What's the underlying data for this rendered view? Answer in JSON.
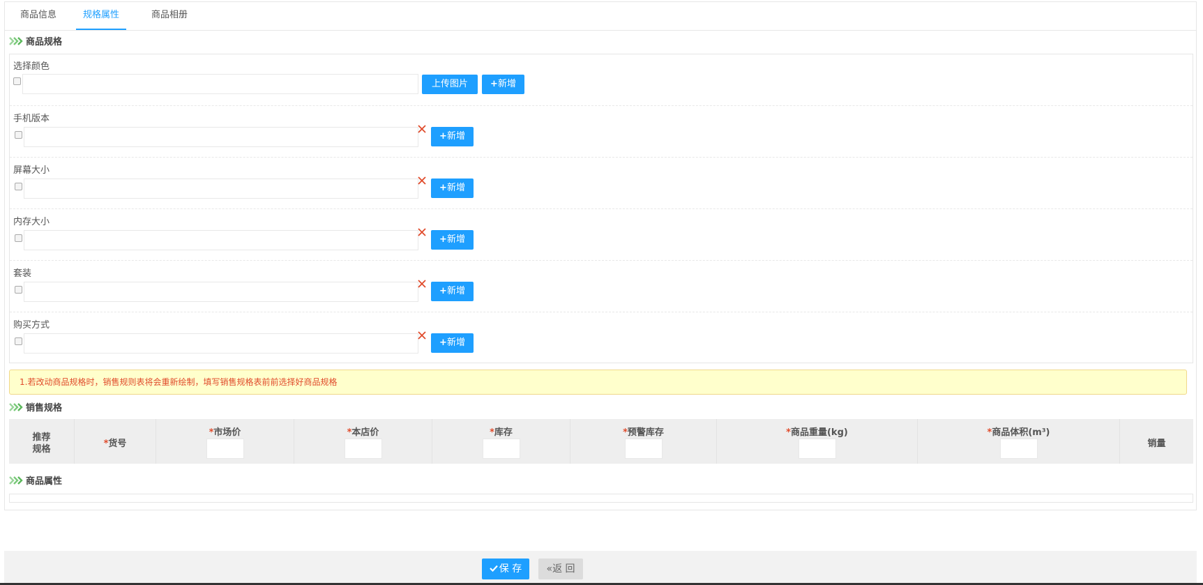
{
  "tabs": [
    {
      "label": "商品信息"
    },
    {
      "label": "规格属性"
    },
    {
      "label": "商品相册"
    }
  ],
  "spec_section": {
    "title": "商品规格"
  },
  "spec_groups": [
    {
      "label": "选择颜色",
      "value": ""
    },
    {
      "label": "手机版本",
      "value": ""
    },
    {
      "label": "屏幕大小",
      "value": ""
    },
    {
      "label": "内存大小",
      "value": ""
    },
    {
      "label": "套装",
      "value": ""
    },
    {
      "label": "购买方式",
      "value": ""
    }
  ],
  "buttons": {
    "upload": "上传图片",
    "add": "新增",
    "add_icon": "+"
  },
  "warning": {
    "text": "1.若改动商品规格时，销售规则表将会重新绘制，填写销售规格表前前选择好商品规格"
  },
  "sales_section": {
    "title": "销售规格"
  },
  "sales_columns": [
    {
      "label": "推荐\n规格",
      "line1": "推荐",
      "line2": "规格",
      "required": false
    },
    {
      "label": "货号",
      "required": true
    },
    {
      "label": "市场价",
      "required": true
    },
    {
      "label": "本店价",
      "required": true
    },
    {
      "label": "库存",
      "required": true
    },
    {
      "label": "预警库存",
      "required": true
    },
    {
      "label": "商品重量(kg)",
      "required": true
    },
    {
      "label": "商品体积(m³)",
      "required": true
    },
    {
      "label": "销量",
      "required": false
    }
  ],
  "required_mark": "*",
  "attr_section": {
    "title": "商品属性"
  },
  "footer": {
    "save_label": "保 存",
    "back_label": "返 回",
    "back_icon": "«"
  },
  "colors": {
    "accent": "#1e9fff",
    "danger": "#e04b2b",
    "warning_bg": "#ffffcc",
    "chevron": "#7ac97a"
  }
}
